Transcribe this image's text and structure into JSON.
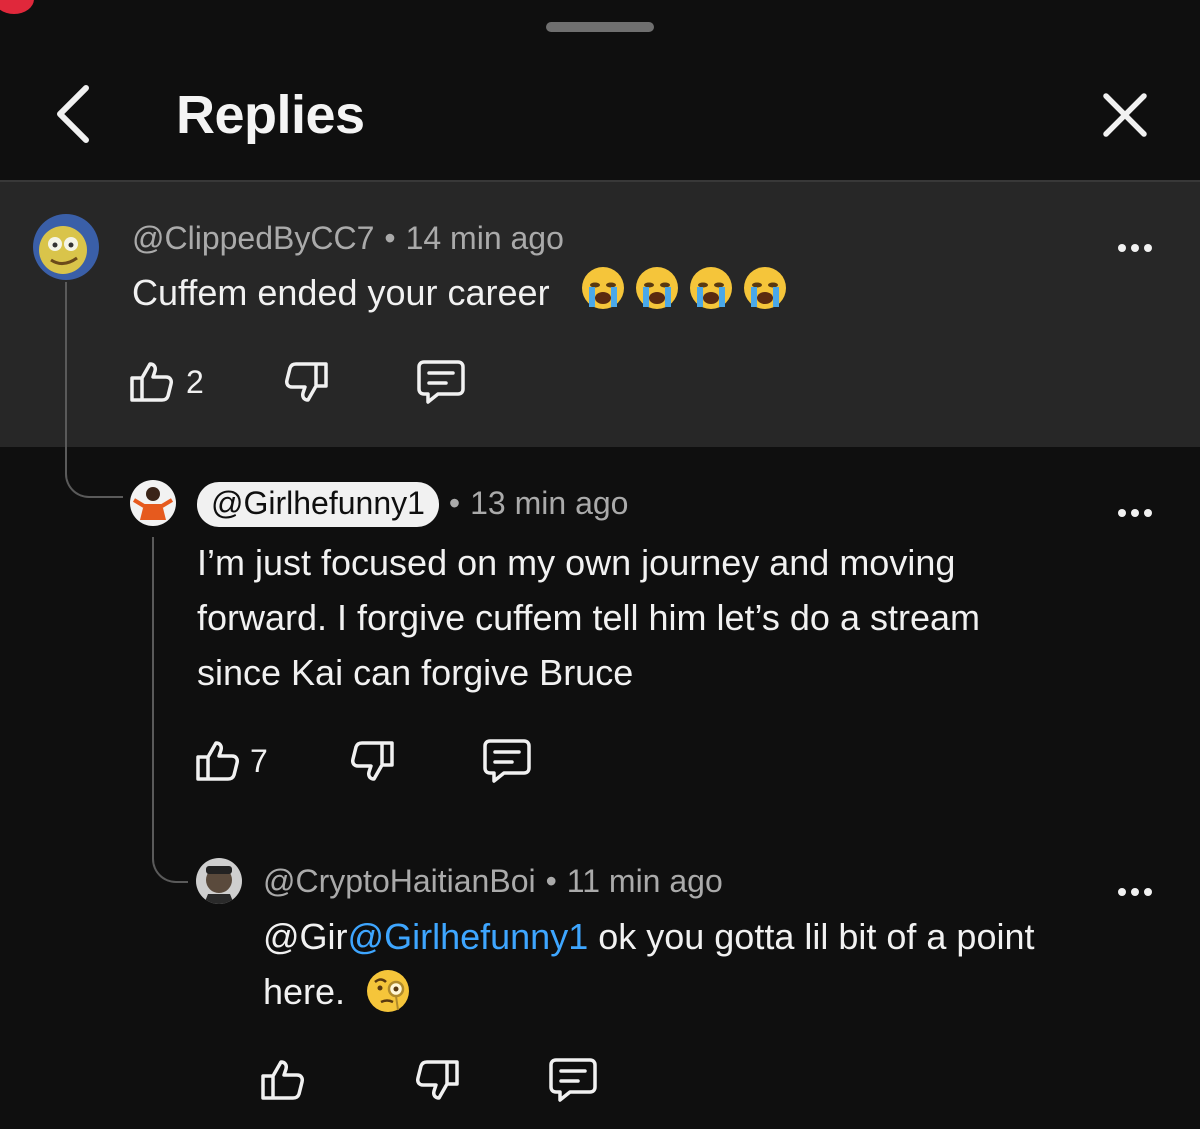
{
  "header": {
    "title": "Replies"
  },
  "comments": [
    {
      "author": "@ClippedByCC7",
      "separator": "•",
      "time": "14 min ago",
      "text": "Cuffem ended your career",
      "emojis": [
        "loudly-crying-face",
        "loudly-crying-face",
        "loudly-crying-face",
        "loudly-crying-face"
      ],
      "likes": "2",
      "avatar_color": "#d9c44a"
    },
    {
      "author": "@Girlhefunny1",
      "separator": "•",
      "time": "13 min ago",
      "text_lines": [
        "I’m just focused on my own journey and moving",
        "forward. I forgive cuffem tell him let’s do a stream",
        "since Kai can forgive Bruce"
      ],
      "likes": "7",
      "author_highlighted": true,
      "avatar_color": "#e65a1e"
    },
    {
      "author": "@CryptoHaitianBoi",
      "separator": "•",
      "time": "11 min ago",
      "text_prefix": "@Gir",
      "mention": "@Girlhefunny1",
      "text_rest": " ok you gotta lil bit of a point",
      "text_line2": "here.",
      "emoji": "face-with-monocle",
      "likes": "",
      "avatar_color": "#5a4a3c"
    }
  ],
  "colors": {
    "background": "#0f0f0f",
    "parent_highlight": "#272727",
    "mention": "#3ea6ff",
    "meta": "#aaaaaa"
  }
}
